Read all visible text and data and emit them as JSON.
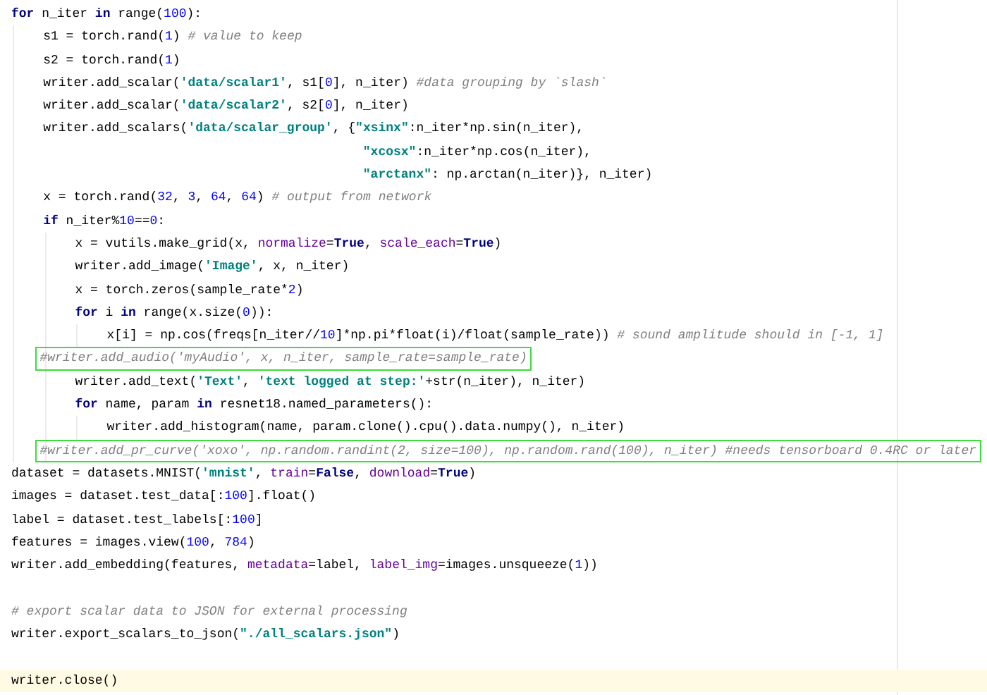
{
  "editor": {
    "lines": [
      {
        "kind": "code",
        "tokens": [
          {
            "kind": "keyword",
            "text": "for"
          },
          {
            "kind": "plain",
            "text": " n_iter "
          },
          {
            "kind": "keyword",
            "text": "in"
          },
          {
            "kind": "plain",
            "text": " range("
          },
          {
            "kind": "number",
            "text": "100"
          },
          {
            "kind": "plain",
            "text": "):"
          }
        ],
        "children": [
          {
            "kind": "code",
            "tokens": [
              {
                "kind": "plain",
                "text": "s1 = torch.rand("
              },
              {
                "kind": "number",
                "text": "1"
              },
              {
                "kind": "plain",
                "text": ") "
              },
              {
                "kind": "comment",
                "text": "# value to keep"
              }
            ]
          },
          {
            "kind": "code",
            "tokens": [
              {
                "kind": "plain",
                "text": "s2 = torch.rand("
              },
              {
                "kind": "number",
                "text": "1"
              },
              {
                "kind": "plain",
                "text": ")"
              }
            ]
          },
          {
            "kind": "code",
            "tokens": [
              {
                "kind": "plain",
                "text": "writer.add_scalar("
              },
              {
                "kind": "string",
                "text": "'data/scalar1'"
              },
              {
                "kind": "plain",
                "text": ", s1["
              },
              {
                "kind": "number",
                "text": "0"
              },
              {
                "kind": "plain",
                "text": "], n_iter) "
              },
              {
                "kind": "comment",
                "text": "#data grouping by `slash`"
              }
            ]
          },
          {
            "kind": "code",
            "tokens": [
              {
                "kind": "plain",
                "text": "writer.add_scalar("
              },
              {
                "kind": "string",
                "text": "'data/scalar2'"
              },
              {
                "kind": "plain",
                "text": ", s2["
              },
              {
                "kind": "number",
                "text": "0"
              },
              {
                "kind": "plain",
                "text": "], n_iter)"
              }
            ]
          },
          {
            "kind": "code",
            "tokens": [
              {
                "kind": "plain",
                "text": "writer.add_scalars("
              },
              {
                "kind": "string",
                "text": "'data/scalar_group'"
              },
              {
                "kind": "plain",
                "text": ", {"
              },
              {
                "kind": "string",
                "text": "\"xsinx\""
              },
              {
                "kind": "plain",
                "text": ":n_iter*np.sin(n_iter),"
              }
            ]
          },
          {
            "kind": "continuation",
            "tokens": [
              {
                "kind": "string",
                "text": "\"xcosx\""
              },
              {
                "kind": "plain",
                "text": ":n_iter*np.cos(n_iter),"
              }
            ]
          },
          {
            "kind": "continuation",
            "tokens": [
              {
                "kind": "string",
                "text": "\"arctanx\""
              },
              {
                "kind": "plain",
                "text": ": np.arctan(n_iter)}, n_iter)"
              }
            ]
          },
          {
            "kind": "code",
            "tokens": [
              {
                "kind": "plain",
                "text": "x = torch.rand("
              },
              {
                "kind": "number",
                "text": "32"
              },
              {
                "kind": "plain",
                "text": ", "
              },
              {
                "kind": "number",
                "text": "3"
              },
              {
                "kind": "plain",
                "text": ", "
              },
              {
                "kind": "number",
                "text": "64"
              },
              {
                "kind": "plain",
                "text": ", "
              },
              {
                "kind": "number",
                "text": "64"
              },
              {
                "kind": "plain",
                "text": ") "
              },
              {
                "kind": "comment",
                "text": "# output from network"
              }
            ]
          },
          {
            "kind": "code",
            "tokens": [
              {
                "kind": "keyword",
                "text": "if"
              },
              {
                "kind": "plain",
                "text": " n_iter%"
              },
              {
                "kind": "number",
                "text": "10"
              },
              {
                "kind": "plain",
                "text": "=="
              },
              {
                "kind": "number",
                "text": "0"
              },
              {
                "kind": "plain",
                "text": ":"
              }
            ],
            "children": [
              {
                "kind": "code",
                "tokens": [
                  {
                    "kind": "plain",
                    "text": "x = vutils.make_grid(x, "
                  },
                  {
                    "kind": "param",
                    "text": "normalize"
                  },
                  {
                    "kind": "plain",
                    "text": "="
                  },
                  {
                    "kind": "keyword",
                    "text": "True"
                  },
                  {
                    "kind": "plain",
                    "text": ", "
                  },
                  {
                    "kind": "param",
                    "text": "scale_each"
                  },
                  {
                    "kind": "plain",
                    "text": "="
                  },
                  {
                    "kind": "keyword",
                    "text": "True"
                  },
                  {
                    "kind": "plain",
                    "text": ")"
                  }
                ]
              },
              {
                "kind": "code",
                "tokens": [
                  {
                    "kind": "plain",
                    "text": "writer.add_image("
                  },
                  {
                    "kind": "string",
                    "text": "'Image'"
                  },
                  {
                    "kind": "plain",
                    "text": ", x, n_iter)"
                  }
                ]
              },
              {
                "kind": "code",
                "tokens": [
                  {
                    "kind": "plain",
                    "text": "x = torch.zeros(sample_rate*"
                  },
                  {
                    "kind": "number",
                    "text": "2"
                  },
                  {
                    "kind": "plain",
                    "text": ")"
                  }
                ]
              },
              {
                "kind": "code",
                "tokens": [
                  {
                    "kind": "keyword",
                    "text": "for"
                  },
                  {
                    "kind": "plain",
                    "text": " i "
                  },
                  {
                    "kind": "keyword",
                    "text": "in"
                  },
                  {
                    "kind": "plain",
                    "text": " range(x.size("
                  },
                  {
                    "kind": "number",
                    "text": "0"
                  },
                  {
                    "kind": "plain",
                    "text": ")):"
                  }
                ],
                "children": [
                  {
                    "kind": "code",
                    "tokens": [
                      {
                        "kind": "plain",
                        "text": "x[i] = np.cos(freqs[n_iter//"
                      },
                      {
                        "kind": "number",
                        "text": "10"
                      },
                      {
                        "kind": "plain",
                        "text": "]*np.pi*float(i)/float(sample_rate)) "
                      },
                      {
                        "kind": "comment",
                        "text": "# sound amplitude should in [-1, 1]"
                      }
                    ]
                  }
                ]
              },
              {
                "kind": "commented",
                "boxed": true,
                "tokens": [
                  {
                    "kind": "comment",
                    "text": "#writer.add_audio('myAudio', x, n_iter, sample_rate=sample_rate)"
                  }
                ]
              },
              {
                "kind": "code",
                "tokens": [
                  {
                    "kind": "plain",
                    "text": "writer.add_text("
                  },
                  {
                    "kind": "string",
                    "text": "'Text'"
                  },
                  {
                    "kind": "plain",
                    "text": ", "
                  },
                  {
                    "kind": "string",
                    "text": "'text logged at step:'"
                  },
                  {
                    "kind": "plain",
                    "text": "+str(n_iter), n_iter)"
                  }
                ]
              },
              {
                "kind": "code",
                "tokens": [
                  {
                    "kind": "keyword",
                    "text": "for"
                  },
                  {
                    "kind": "plain",
                    "text": " name, param "
                  },
                  {
                    "kind": "keyword",
                    "text": "in"
                  },
                  {
                    "kind": "plain",
                    "text": " resnet18.named_parameters():"
                  }
                ],
                "children": [
                  {
                    "kind": "code",
                    "tokens": [
                      {
                        "kind": "plain",
                        "text": "writer.add_histogram(name, param.clone().cpu().data.numpy(), n_iter)"
                      }
                    ]
                  }
                ]
              },
              {
                "kind": "commented",
                "boxed": true,
                "tokens": [
                  {
                    "kind": "comment",
                    "text": "#writer.add_pr_curve('xoxo', np.random.randint(2, size=100), np.random.rand(100), n_iter) #needs tensorboard 0.4RC or later"
                  }
                ]
              }
            ]
          }
        ]
      },
      {
        "kind": "code",
        "tokens": [
          {
            "kind": "plain",
            "text": "dataset = datasets.MNIST("
          },
          {
            "kind": "string",
            "text": "'mnist'"
          },
          {
            "kind": "plain",
            "text": ", "
          },
          {
            "kind": "param",
            "text": "train"
          },
          {
            "kind": "plain",
            "text": "="
          },
          {
            "kind": "keyword",
            "text": "False"
          },
          {
            "kind": "plain",
            "text": ", "
          },
          {
            "kind": "param",
            "text": "download"
          },
          {
            "kind": "plain",
            "text": "="
          },
          {
            "kind": "keyword",
            "text": "True"
          },
          {
            "kind": "plain",
            "text": ")"
          }
        ]
      },
      {
        "kind": "code",
        "tokens": [
          {
            "kind": "plain",
            "text": "images = dataset.test_data[:"
          },
          {
            "kind": "number",
            "text": "100"
          },
          {
            "kind": "plain",
            "text": "].float()"
          }
        ]
      },
      {
        "kind": "code",
        "tokens": [
          {
            "kind": "plain",
            "text": "label = dataset.test_labels[:"
          },
          {
            "kind": "number",
            "text": "100"
          },
          {
            "kind": "plain",
            "text": "]"
          }
        ]
      },
      {
        "kind": "code",
        "tokens": [
          {
            "kind": "plain",
            "text": "features = images.view("
          },
          {
            "kind": "number",
            "text": "100"
          },
          {
            "kind": "plain",
            "text": ", "
          },
          {
            "kind": "number",
            "text": "784"
          },
          {
            "kind": "plain",
            "text": ")"
          }
        ]
      },
      {
        "kind": "code",
        "tokens": [
          {
            "kind": "plain",
            "text": "writer.add_embedding(features, "
          },
          {
            "kind": "param",
            "text": "metadata"
          },
          {
            "kind": "plain",
            "text": "=label, "
          },
          {
            "kind": "param",
            "text": "label_img"
          },
          {
            "kind": "plain",
            "text": "=images.unsqueeze("
          },
          {
            "kind": "number",
            "text": "1"
          },
          {
            "kind": "plain",
            "text": "))"
          }
        ]
      },
      {
        "kind": "code",
        "blank_before": true,
        "tokens": [
          {
            "kind": "comment",
            "text": "# export scalar data to JSON for external processing"
          }
        ]
      },
      {
        "kind": "code",
        "tokens": [
          {
            "kind": "plain",
            "text": "writer.export_scalars_to_json("
          },
          {
            "kind": "string",
            "text": "\"./all_scalars.json\""
          },
          {
            "kind": "plain",
            "text": ")"
          }
        ]
      },
      {
        "kind": "code",
        "blank_before": true,
        "current": true,
        "tokens": [
          {
            "kind": "plain",
            "text": "writer.close()"
          }
        ]
      }
    ]
  }
}
